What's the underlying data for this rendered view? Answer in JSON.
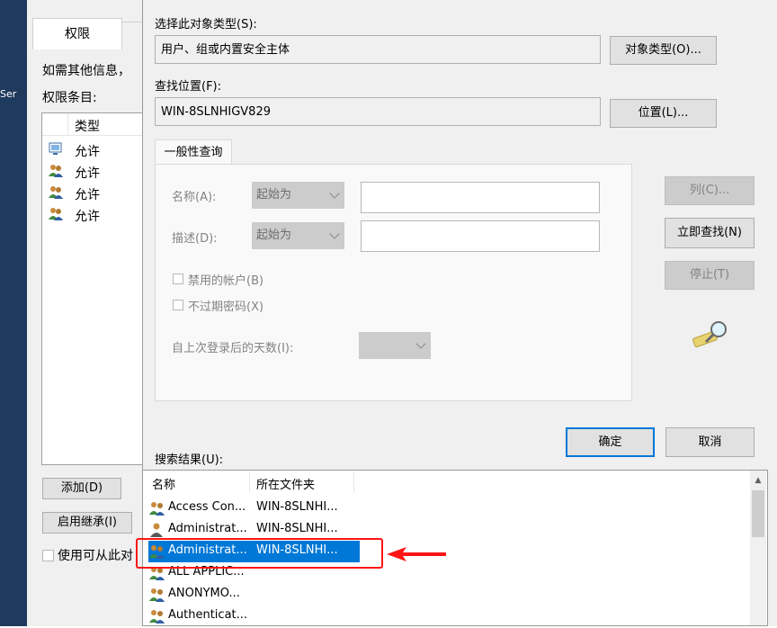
{
  "background_dialog": {
    "tab_permissions": "权限",
    "info_text": "如需其他信息，",
    "entries_label": "权限条目:",
    "column_type": "类型",
    "left_strip_text": "Ser",
    "rows": [
      {
        "type": "允许",
        "icon": "computer-group-icon"
      },
      {
        "type": "允许",
        "icon": "users-group-icon"
      },
      {
        "type": "允许",
        "icon": "users-group-icon"
      },
      {
        "type": "允许",
        "icon": "users-group-icon"
      }
    ],
    "add_button": "添加(D)",
    "enable_inherit_button": "启用继承(I)",
    "use_inheritable_label": "使用可从此对"
  },
  "select_dialog": {
    "object_type_label": "选择此对象类型(S):",
    "object_type_value": "用户、组或内置安全主体",
    "object_type_button": "对象类型(O)...",
    "location_label": "查找位置(F):",
    "location_value": "WIN-8SLNHIGV829",
    "location_button": "位置(L)...",
    "tab_common_queries": "一般性查询",
    "name_label": "名称(A):",
    "name_mode": "起始为",
    "desc_label": "描述(D):",
    "desc_mode": "起始为",
    "disabled_accounts": "禁用的帐户(B)",
    "non_expiring_pwd": "不过期密码(X)",
    "days_since_login": "自上次登录后的天数(I):",
    "columns_button": "列(C)...",
    "find_now_button": "立即查找(N)",
    "stop_button": "停止(T)",
    "search_icon": "search-flashlight-icon",
    "ok_button": "确定",
    "cancel_button": "取消",
    "results_label": "搜索结果(U):",
    "results_headers": {
      "name": "名称",
      "folder": "所在文件夹"
    },
    "results": [
      {
        "name": "Access Con...",
        "folder": "WIN-8SLNHI...",
        "icon": "users-group-icon",
        "selected": false
      },
      {
        "name": "Administrat...",
        "folder": "WIN-8SLNHI...",
        "icon": "user-icon",
        "selected": false
      },
      {
        "name": "Administrat...",
        "folder": "WIN-8SLNHI...",
        "icon": "users-group-icon",
        "selected": true
      },
      {
        "name": "ALL APPLIC...",
        "folder": "",
        "icon": "users-group-icon",
        "selected": false
      },
      {
        "name": "ANONYMO...",
        "folder": "",
        "icon": "users-group-icon",
        "selected": false
      },
      {
        "name": "Authenticat...",
        "folder": "",
        "icon": "users-group-icon",
        "selected": false
      }
    ]
  },
  "annotation": {
    "color": "#ff1414"
  },
  "colors": {
    "accent": "#0078d7",
    "dialog_bg": "#f0f0f0"
  }
}
